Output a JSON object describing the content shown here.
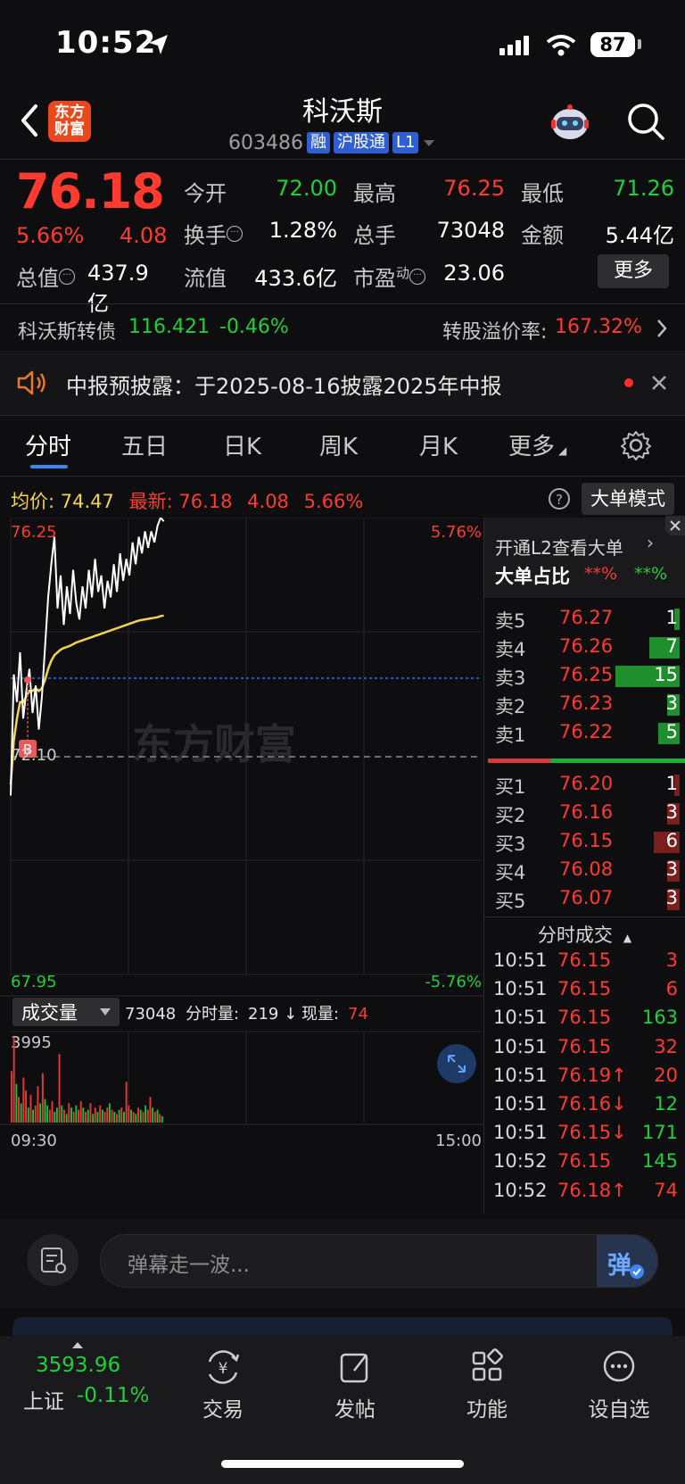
{
  "status": {
    "time": "10:52",
    "battery": "87"
  },
  "header": {
    "title": "科沃斯",
    "code": "603486",
    "tags": [
      "融",
      "沪股通",
      "L1"
    ],
    "logo": [
      "东方",
      "财富"
    ]
  },
  "quote": {
    "price": "76.18",
    "pct": "5.66%",
    "change": "4.08",
    "open_label": "今开",
    "open": "72.00",
    "high_label": "最高",
    "high": "76.25",
    "low_label": "最低",
    "low": "71.26",
    "turnover_label": "换手",
    "turnover": "1.28%",
    "volume_label": "总手",
    "volume": "73048",
    "amount_label": "金额",
    "amount": "5.44亿",
    "mcap_label": "总值",
    "mcap": "437.9亿",
    "float_label": "流值",
    "float": "433.6亿",
    "pe_label": "市盈",
    "pe_sup": "动",
    "pe": "23.06",
    "more_label": "更多"
  },
  "bond": {
    "name": "科沃斯转债",
    "price": "116.421",
    "change": "-0.46%",
    "premium_label": "转股溢价率:",
    "premium": "167.32%"
  },
  "notice": {
    "text": "中报预披露：于2025-08-16披露2025年中报"
  },
  "tabs": [
    "分时",
    "五日",
    "日K",
    "周K",
    "月K",
    "更多"
  ],
  "chart_header": {
    "avg_label": "均价:",
    "avg": "74.47",
    "latest_label": "最新:",
    "latest": "76.18",
    "latest_change": "4.08",
    "latest_pct": "5.66%",
    "mode_label": "大单模式"
  },
  "chart_labels": {
    "top": "76.25",
    "top_pct": "5.76%",
    "bottom": "67.95",
    "bottom_pct": "-5.76%",
    "mid": "72.10",
    "watermark": "东方财富",
    "b_marker": "B",
    "vol_label": "成交量",
    "vol_total": "73048",
    "vol_period_label": "分时量:",
    "vol_period": "219 ↓",
    "vol_now_label": "现量:",
    "vol_now": "74",
    "vol_max": "3995",
    "time_start": "09:30",
    "time_end": "15:00"
  },
  "chart_data": {
    "type": "line",
    "ylim": [
      67.95,
      76.25
    ],
    "prev_close": 72.1,
    "time_range": [
      "09:30",
      "15:00"
    ],
    "series": [
      {
        "values": [
          71.2,
          73.4,
          72.9,
          73.8,
          72.6,
          73.1,
          73.5,
          72.7,
          73.2,
          72.4,
          73.0,
          73.9,
          74.8,
          75.4,
          75.9,
          74.6,
          75.2,
          74.3,
          75.0,
          74.5,
          75.3,
          74.7,
          74.4,
          75.0,
          74.6,
          75.3,
          74.8,
          75.5,
          74.9,
          75.2,
          74.6,
          75.1,
          74.8,
          75.4,
          74.9,
          75.6,
          75.1,
          75.5,
          75.2,
          75.8,
          75.4,
          75.9,
          75.6,
          76.0,
          75.7,
          76.0,
          75.8,
          76.1,
          76.25,
          76.18
        ]
      },
      {
        "values": [
          71.4,
          72.2,
          72.6,
          72.9,
          72.9,
          73.0,
          73.1,
          73.1,
          73.15,
          73.1,
          73.15,
          73.3,
          73.5,
          73.65,
          73.75,
          73.8,
          73.85,
          73.88,
          73.9,
          73.92,
          73.95,
          73.98,
          74.0,
          74.02,
          74.04,
          74.06,
          74.08,
          74.1,
          74.12,
          74.14,
          74.16,
          74.18,
          74.2,
          74.22,
          74.24,
          74.26,
          74.28,
          74.3,
          74.32,
          74.34,
          74.36,
          74.38,
          74.39,
          74.4,
          74.41,
          74.42,
          74.43,
          74.44,
          74.46,
          74.47
        ]
      }
    ]
  },
  "volume_data": {
    "max": 3995,
    "bars": [
      2400,
      3995,
      1800,
      1200,
      900,
      2100,
      1500,
      700,
      1300,
      600,
      800,
      1700,
      900,
      2300,
      1100,
      800,
      600,
      1000,
      500,
      700,
      3200,
      800,
      600,
      400,
      900,
      700,
      500,
      800,
      600,
      1000,
      700,
      500,
      600,
      900,
      400,
      700,
      500,
      800,
      600,
      500,
      700,
      900,
      600,
      500,
      400,
      600,
      700,
      500,
      1900,
      800,
      600,
      500,
      400,
      700,
      600,
      500,
      800,
      600,
      1200,
      700,
      500,
      600,
      400,
      300
    ],
    "colors": [
      "r",
      "r",
      "g",
      "r",
      "g",
      "r",
      "r",
      "g",
      "r",
      "g",
      "r",
      "r",
      "g",
      "r",
      "g",
      "g",
      "r",
      "r",
      "g",
      "g",
      "r",
      "g",
      "r",
      "g",
      "r",
      "g",
      "r",
      "g",
      "r",
      "r",
      "g",
      "r",
      "g",
      "r",
      "g",
      "r",
      "g",
      "r",
      "g",
      "r",
      "r",
      "g",
      "r",
      "g",
      "r",
      "g",
      "r",
      "g",
      "r",
      "r",
      "g",
      "r",
      "g",
      "r",
      "g",
      "r",
      "g",
      "r",
      "r",
      "g",
      "r",
      "g",
      "r",
      "g"
    ]
  },
  "orderbook": {
    "banner": "开通L2查看大单",
    "ratio_label": "大单占比",
    "ratio_red": "**%",
    "ratio_green": "**%",
    "asks": [
      {
        "label": "卖5",
        "price": "76.27",
        "vol": "1"
      },
      {
        "label": "卖4",
        "price": "76.26",
        "vol": "7"
      },
      {
        "label": "卖3",
        "price": "76.25",
        "vol": "15"
      },
      {
        "label": "卖2",
        "price": "76.23",
        "vol": "3"
      },
      {
        "label": "卖1",
        "price": "76.22",
        "vol": "5"
      }
    ],
    "bids": [
      {
        "label": "买1",
        "price": "76.20",
        "vol": "1"
      },
      {
        "label": "买2",
        "price": "76.16",
        "vol": "3"
      },
      {
        "label": "买3",
        "price": "76.15",
        "vol": "6"
      },
      {
        "label": "买4",
        "price": "76.08",
        "vol": "3"
      },
      {
        "label": "买5",
        "price": "76.07",
        "vol": "3"
      }
    ],
    "trades_label": "分时成交",
    "trades": [
      {
        "time": "10:51",
        "price": "76.15",
        "vol": "3",
        "vc": "r"
      },
      {
        "time": "10:51",
        "price": "76.15",
        "vol": "6",
        "vc": "r"
      },
      {
        "time": "10:51",
        "price": "76.15",
        "vol": "163",
        "vc": "g"
      },
      {
        "time": "10:51",
        "price": "76.15",
        "vol": "32",
        "vc": "r"
      },
      {
        "time": "10:51",
        "price": "76.19↑",
        "vol": "20",
        "vc": "r"
      },
      {
        "time": "10:51",
        "price": "76.16↓",
        "vol": "12",
        "vc": "g"
      },
      {
        "time": "10:51",
        "price": "76.15↓",
        "vol": "171",
        "vc": "g"
      },
      {
        "time": "10:52",
        "price": "76.15",
        "vol": "145",
        "vc": "g"
      },
      {
        "time": "10:52",
        "price": "76.18↑",
        "vol": "74",
        "vc": "r"
      }
    ]
  },
  "comment": {
    "placeholder": "弹幕走一波...",
    "send_glyph": "弹"
  },
  "tabbar": {
    "index_value": "3593.96",
    "index_name": "上证",
    "index_change": "-0.11%",
    "items": [
      "交易",
      "发帖",
      "功能",
      "设自选"
    ]
  }
}
